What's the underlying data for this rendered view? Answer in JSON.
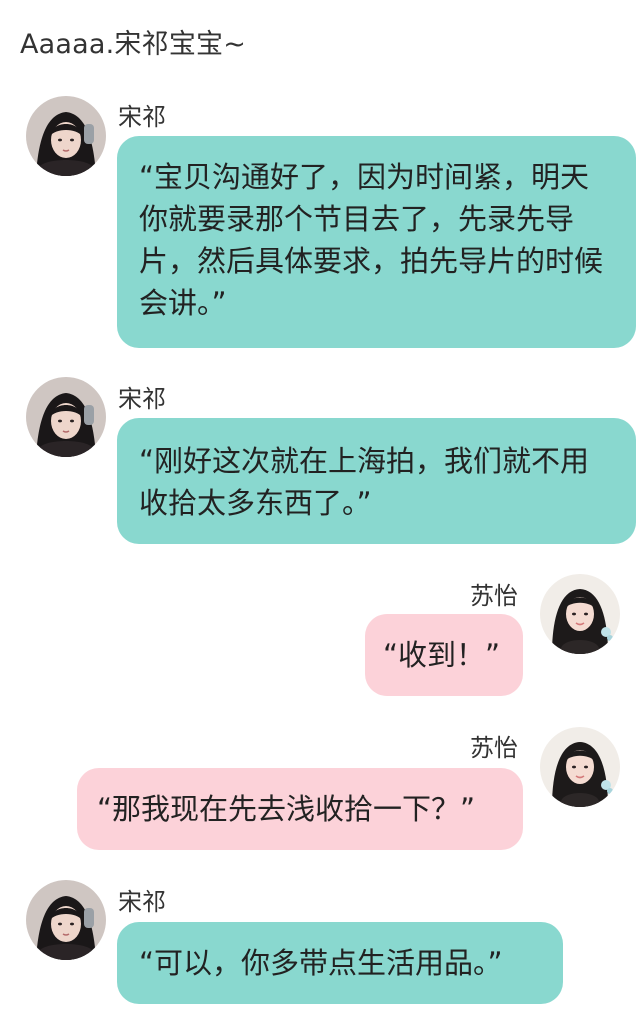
{
  "header": {
    "title": "Aaaaa.宋祁宝宝~"
  },
  "messages": [
    {
      "sender": "宋祁",
      "text": "“宝贝沟通好了，因为时间紧，明天你就要录那个节目去了，先录先导片，然后具体要求，拍先导片的时候会讲。”",
      "side": "left"
    },
    {
      "sender": "宋祁",
      "text": "“刚好这次就在上海拍，我们就不用收拾太多东西了。”",
      "side": "left"
    },
    {
      "sender": "苏怡",
      "text": "“收到！”",
      "side": "right"
    },
    {
      "sender": "苏怡",
      "text": "“那我现在先去浅收拾一下？”",
      "side": "right"
    },
    {
      "sender": "宋祁",
      "text": "“可以，你多带点生活用品。”",
      "side": "left"
    }
  ],
  "colors": {
    "left_bubble": "#89d8cf",
    "right_bubble": "#fcd2d9"
  },
  "icons": {
    "left_avatar": "avatar-songqi",
    "right_avatar": "avatar-suyi"
  }
}
